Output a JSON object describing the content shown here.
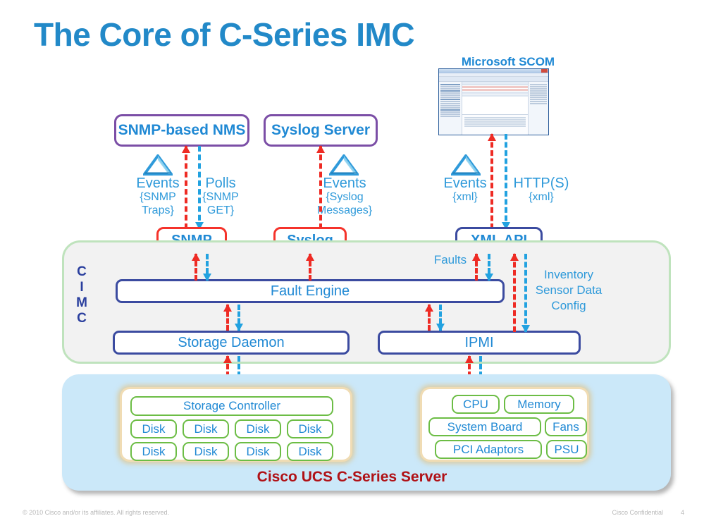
{
  "slide": {
    "title": "The Core of C-Series IMC",
    "page_number": "4",
    "footer_copyright": "© 2010 Cisco and/or its affiliates. All rights reserved.",
    "footer_classification": "Cisco Confidential",
    "server_caption": "Cisco UCS C-Series Server",
    "cimc_letters": [
      "C",
      "I",
      "M",
      "C"
    ]
  },
  "colors": {
    "title_blue": "#2289c8",
    "box_text_blue": "#2089d4",
    "purple_border": "#7b4ea6",
    "red_border": "#f5332b",
    "navy_border": "#3b4ba0",
    "green_border": "#6cbd45",
    "cimc_panel_fill": "#f2f2f2",
    "cimc_panel_border": "#bfe3bd",
    "server_panel_fill": "#cbe8f9",
    "subgroup_border": "#f0dcb4",
    "caption_red": "#b01116",
    "arrow_events_red": "#ee2b24",
    "arrow_request_blue": "#22a2e0",
    "label_blue": "#2f9ada"
  },
  "consumers": [
    {
      "id": "snmp-nms",
      "label": "SNMP-based NMS"
    },
    {
      "id": "syslog-server",
      "label": "Syslog Server"
    }
  ],
  "scom": {
    "title": "Microsoft SCOM",
    "icon": "application-window-screenshot"
  },
  "flows": [
    {
      "id": "snmp-events",
      "primary": "Events",
      "secondary_line1": "{SNMP",
      "secondary_line2": "Traps}",
      "direction": "up",
      "color": "red"
    },
    {
      "id": "snmp-polls",
      "primary": "Polls",
      "secondary_line1": "{SNMP",
      "secondary_line2": "GET}",
      "direction": "down",
      "color": "blue"
    },
    {
      "id": "syslog-events",
      "primary": "Events",
      "secondary_line1": "{Syslog",
      "secondary_line2": "Messages}",
      "direction": "up",
      "color": "red"
    },
    {
      "id": "xml-events",
      "primary": "Events",
      "secondary_line1": "{xml}",
      "secondary_line2": "",
      "direction": "up",
      "color": "red"
    },
    {
      "id": "xml-https",
      "primary": "HTTP(S)",
      "secondary_line1": "{xml}",
      "secondary_line2": "",
      "direction": "down",
      "color": "blue"
    }
  ],
  "interfaces": [
    {
      "id": "snmp",
      "label": "SNMP",
      "border": "red"
    },
    {
      "id": "syslog",
      "label": "Syslog",
      "border": "red"
    },
    {
      "id": "xml-api",
      "label": "XML API",
      "border": "navy"
    }
  ],
  "cimc": {
    "fault_engine": "Fault Engine",
    "storage_daemon": "Storage Daemon",
    "ipmi": "IPMI",
    "faults_label": "Faults",
    "xmlapi_data_label": {
      "line1": "Inventory",
      "line2": "Sensor Data",
      "line3": "Config"
    }
  },
  "server": {
    "storage_group": {
      "controller": "Storage Controller",
      "disks": [
        "Disk",
        "Disk",
        "Disk",
        "Disk",
        "Disk",
        "Disk",
        "Disk",
        "Disk"
      ]
    },
    "hardware_group": {
      "row1": [
        "CPU",
        "Memory"
      ],
      "row2": [
        "System Board",
        "Fans"
      ],
      "row3": [
        "PCI Adaptors",
        "PSU"
      ]
    }
  }
}
